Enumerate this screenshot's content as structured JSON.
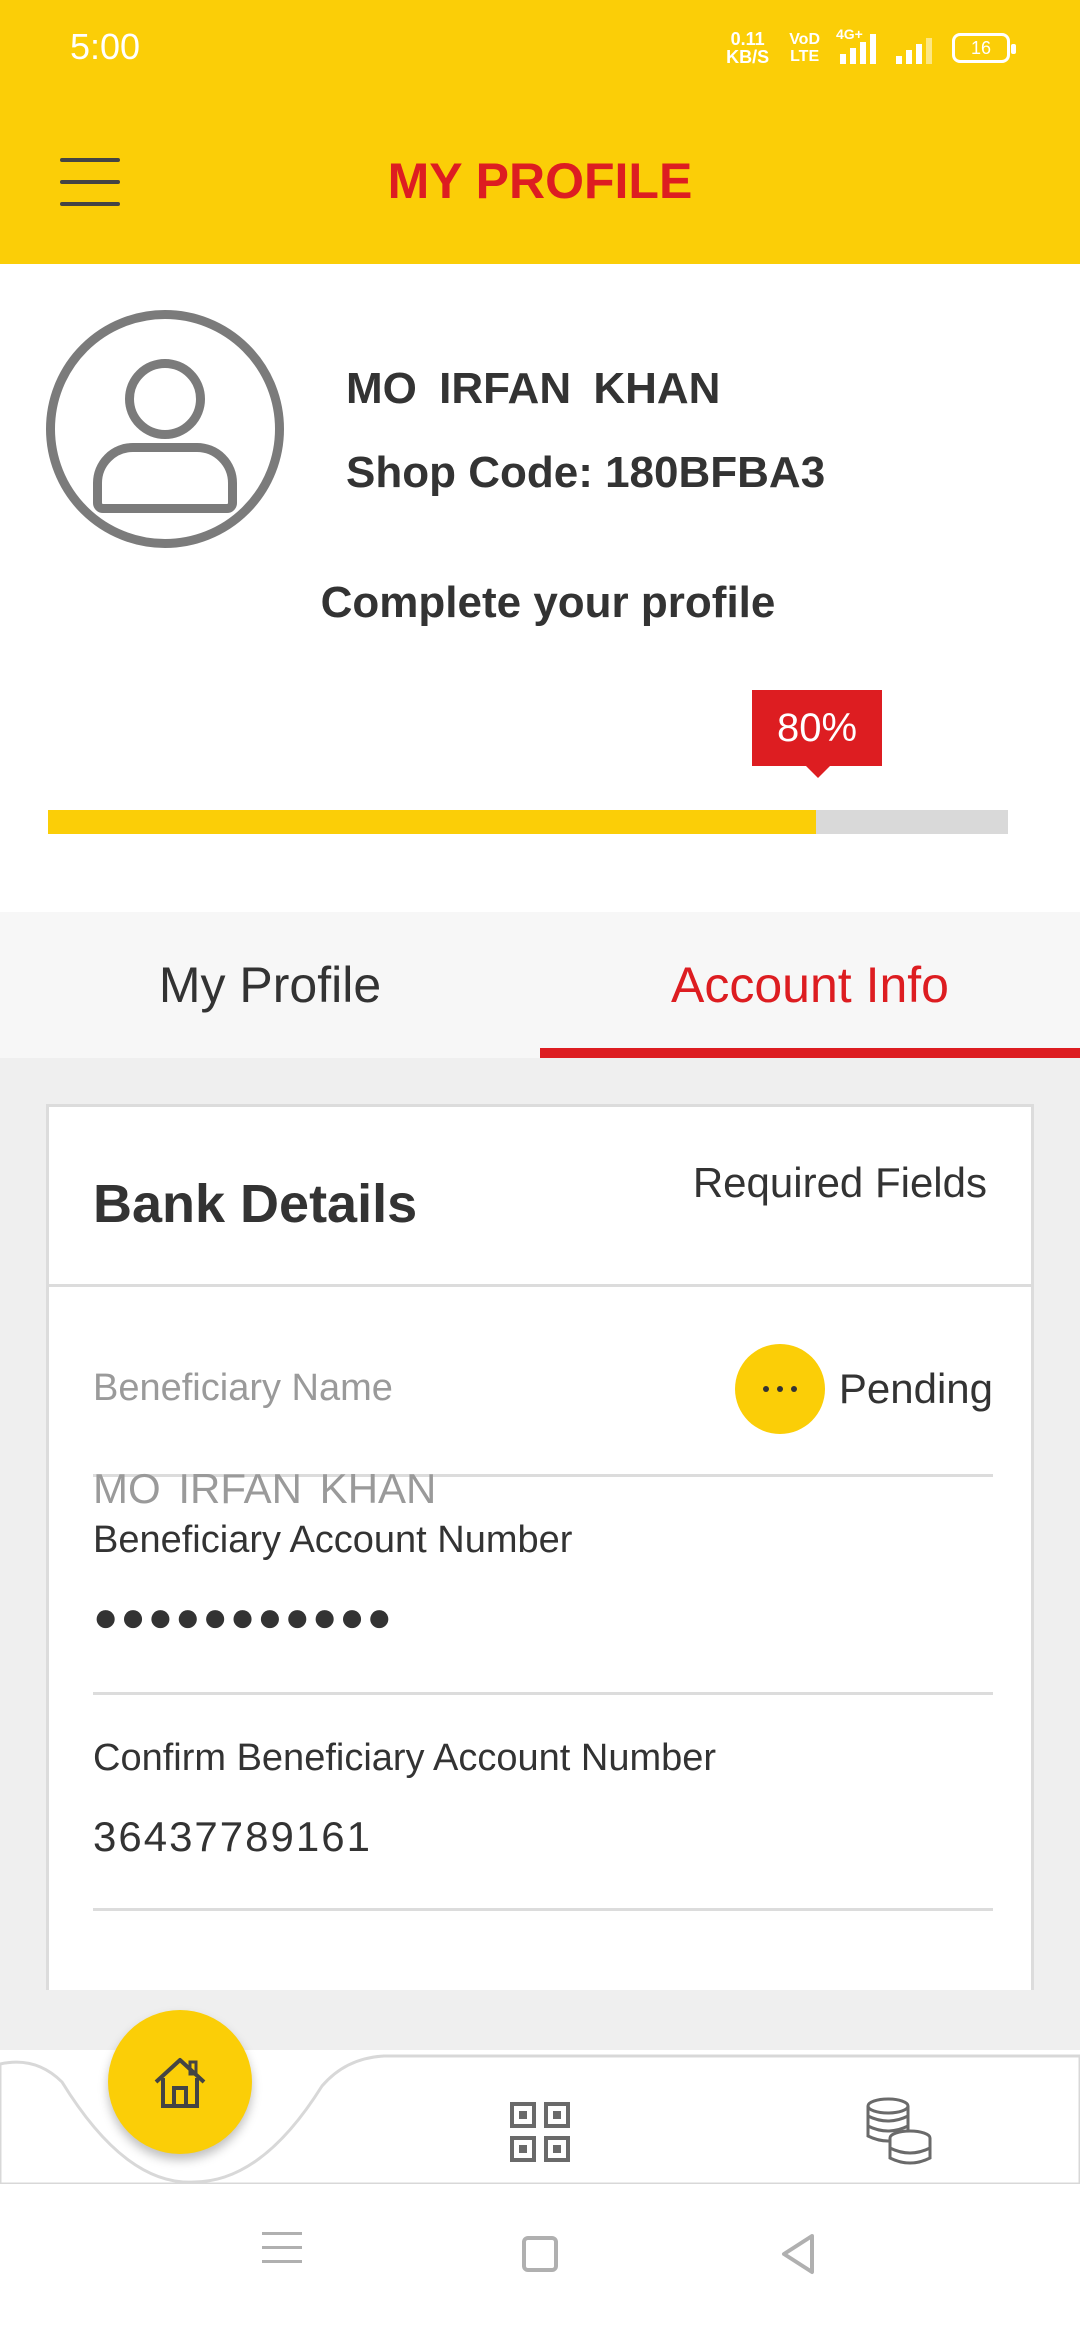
{
  "status_bar": {
    "time": "5:00",
    "speed_value": "0.11",
    "speed_unit": "KB/S",
    "volte_top": "VoD",
    "volte_bottom": "LTE",
    "network_type": "4G+",
    "battery": "16"
  },
  "header": {
    "title": "MY PROFILE",
    "menu_icon": "hamburger-menu-icon"
  },
  "profile": {
    "avatar_icon": "user-avatar-icon",
    "name": "MO  IRFAN  KHAN",
    "shop_code": "Shop Code: 180BFBA3",
    "complete_title": "Complete your profile",
    "progress_label": "80%",
    "progress_value": 0.8
  },
  "tabs": [
    {
      "label": "My Profile",
      "active": false
    },
    {
      "label": "Account Info",
      "active": true
    }
  ],
  "bank_details": {
    "title": "Bank Details",
    "required_label": "Required Fields",
    "fields": [
      {
        "label": "Beneficiary Name",
        "value": "MO  IRFAN KHAN",
        "status": "Pending"
      },
      {
        "label": "Beneficiary Account Number",
        "value": "●●●●●●●●●●●"
      },
      {
        "label": "Confirm Beneficiary Account Number",
        "value": "36437789161"
      }
    ]
  },
  "bottom_nav": {
    "items": [
      {
        "icon": "home-icon"
      },
      {
        "icon": "qr-code-icon"
      },
      {
        "icon": "coins-icon"
      }
    ]
  },
  "system_nav": {
    "items": [
      {
        "icon": "recent-apps-icon"
      },
      {
        "icon": "home-square-icon"
      },
      {
        "icon": "back-triangle-icon"
      }
    ]
  },
  "colors": {
    "accent_yellow": "#FBCE07",
    "accent_red": "#DD1D21"
  }
}
